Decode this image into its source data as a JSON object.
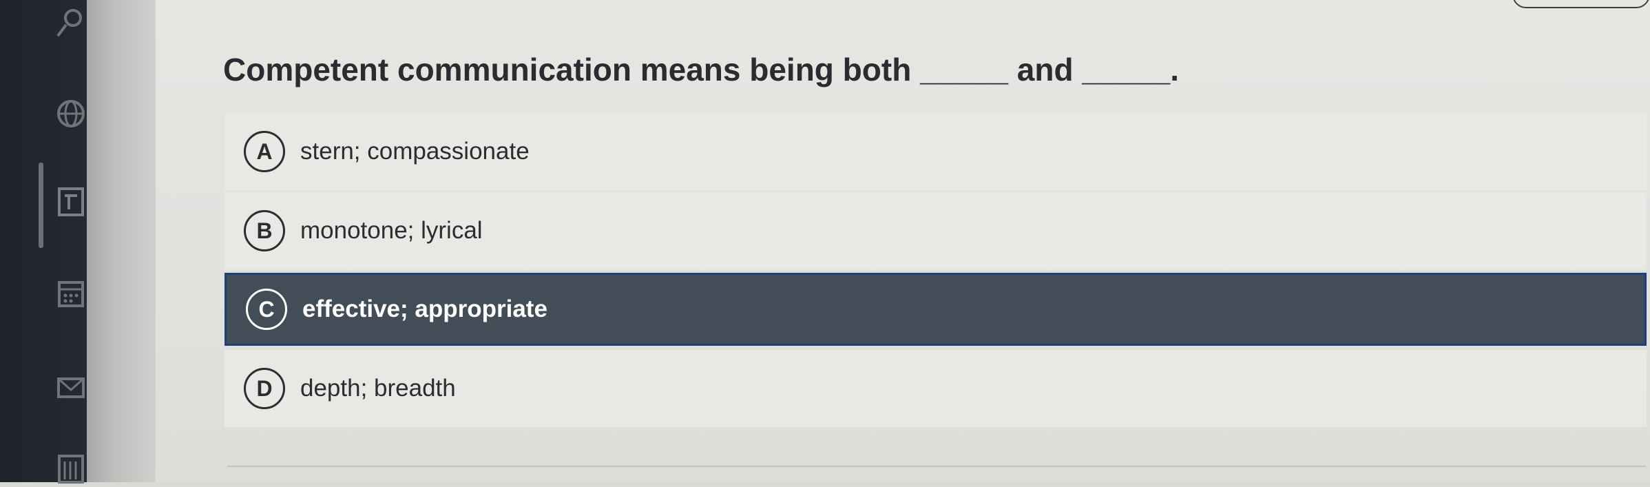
{
  "question": {
    "text": "Competent communication means being both _____ and _____."
  },
  "options": [
    {
      "letter": "A",
      "text": "stern; compassionate",
      "selected": false
    },
    {
      "letter": "B",
      "text": "monotone; lyrical",
      "selected": false
    },
    {
      "letter": "C",
      "text": "effective; appropriate",
      "selected": true
    },
    {
      "letter": "D",
      "text": "depth; breadth",
      "selected": false
    }
  ],
  "sidebar": {
    "icons": [
      "user-icon",
      "globe-icon",
      "assignment-icon",
      "calendar-icon",
      "mail-icon",
      "notes-icon"
    ],
    "active_index": 2
  },
  "colors": {
    "selected_background": "#434d58",
    "selected_border": "#1f3f7a",
    "sidebar_background": "#1f232a",
    "text": "#2b2d31"
  }
}
